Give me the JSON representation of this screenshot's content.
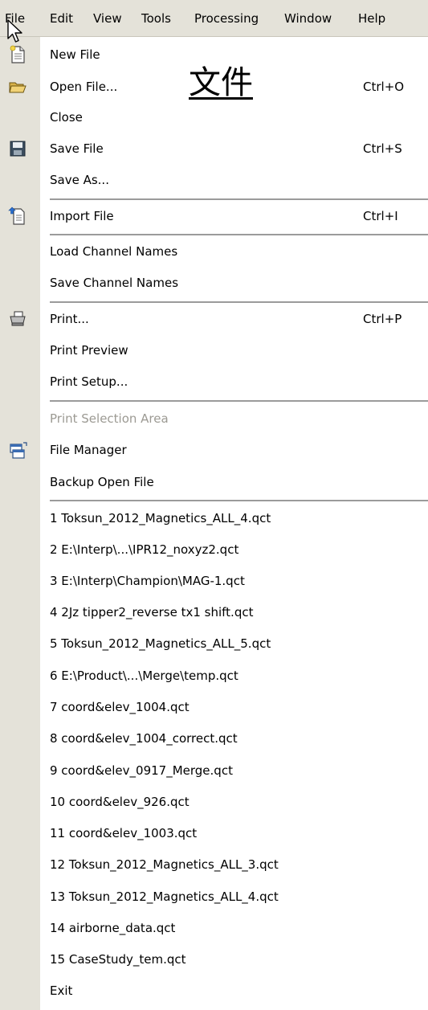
{
  "menubar": {
    "items": [
      "File",
      "Edit",
      "View",
      "Tools",
      "Processing",
      "Window",
      "Help"
    ]
  },
  "annotation": "文件",
  "menu": {
    "new_file": {
      "label": "New File",
      "shortcut": "",
      "icon": "new-file-icon"
    },
    "open_file": {
      "label": "Open File...",
      "shortcut": "Ctrl+O",
      "icon": "open-folder-icon"
    },
    "close": {
      "label": "Close",
      "shortcut": ""
    },
    "save_file": {
      "label": "Save File",
      "shortcut": "Ctrl+S",
      "icon": "floppy-disk-icon"
    },
    "save_as": {
      "label": "Save As...",
      "shortcut": ""
    },
    "import_file": {
      "label": "Import File",
      "shortcut": "Ctrl+I",
      "icon": "import-file-icon"
    },
    "load_channel_names": {
      "label": "Load Channel Names",
      "shortcut": ""
    },
    "save_channel_names": {
      "label": "Save Channel Names",
      "shortcut": ""
    },
    "print": {
      "label": "Print...",
      "shortcut": "Ctrl+P",
      "icon": "printer-icon"
    },
    "print_preview": {
      "label": "Print Preview",
      "shortcut": ""
    },
    "print_setup": {
      "label": "Print Setup...",
      "shortcut": ""
    },
    "print_selection_area": {
      "label": "Print Selection Area",
      "shortcut": "",
      "disabled": true
    },
    "file_manager": {
      "label": "File Manager",
      "shortcut": "",
      "icon": "file-manager-icon"
    },
    "backup_open_file": {
      "label": "Backup Open File",
      "shortcut": ""
    },
    "recent_files": [
      "1 Toksun_2012_Magnetics_ALL_4.qct",
      "2 E:\\Interp\\...\\IPR12_noxyz2.qct",
      "3 E:\\Interp\\Champion\\MAG-1.qct",
      "4 2Jz tipper2_reverse tx1 shift.qct",
      "5 Toksun_2012_Magnetics_ALL_5.qct",
      "6 E:\\Product\\...\\Merge\\temp.qct",
      "7 coord&elev_1004.qct",
      "8 coord&elev_1004_correct.qct",
      "9 coord&elev_0917_Merge.qct",
      "10 coord&elev_926.qct",
      "11 coord&elev_1003.qct",
      "12 Toksun_2012_Magnetics_ALL_3.qct",
      "13 Toksun_2012_Magnetics_ALL_4.qct",
      "14 airborne_data.qct",
      "15 CaseStudy_tem.qct"
    ],
    "exit": {
      "label": "Exit",
      "shortcut": ""
    }
  }
}
